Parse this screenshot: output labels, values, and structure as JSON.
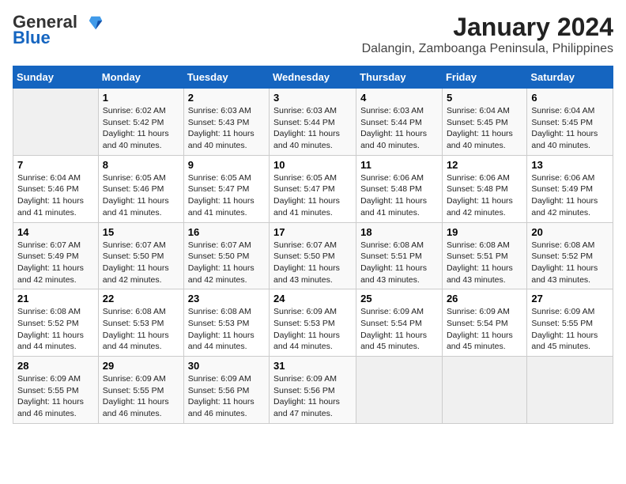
{
  "header": {
    "logo_line1": "General",
    "logo_line2": "Blue",
    "main_title": "January 2024",
    "subtitle": "Dalangin, Zamboanga Peninsula, Philippines"
  },
  "days_of_week": [
    "Sunday",
    "Monday",
    "Tuesday",
    "Wednesday",
    "Thursday",
    "Friday",
    "Saturday"
  ],
  "weeks": [
    [
      {
        "day": "",
        "sunrise": "",
        "sunset": "",
        "daylight": ""
      },
      {
        "day": "1",
        "sunrise": "Sunrise: 6:02 AM",
        "sunset": "Sunset: 5:42 PM",
        "daylight": "Daylight: 11 hours and 40 minutes."
      },
      {
        "day": "2",
        "sunrise": "Sunrise: 6:03 AM",
        "sunset": "Sunset: 5:43 PM",
        "daylight": "Daylight: 11 hours and 40 minutes."
      },
      {
        "day": "3",
        "sunrise": "Sunrise: 6:03 AM",
        "sunset": "Sunset: 5:44 PM",
        "daylight": "Daylight: 11 hours and 40 minutes."
      },
      {
        "day": "4",
        "sunrise": "Sunrise: 6:03 AM",
        "sunset": "Sunset: 5:44 PM",
        "daylight": "Daylight: 11 hours and 40 minutes."
      },
      {
        "day": "5",
        "sunrise": "Sunrise: 6:04 AM",
        "sunset": "Sunset: 5:45 PM",
        "daylight": "Daylight: 11 hours and 40 minutes."
      },
      {
        "day": "6",
        "sunrise": "Sunrise: 6:04 AM",
        "sunset": "Sunset: 5:45 PM",
        "daylight": "Daylight: 11 hours and 40 minutes."
      }
    ],
    [
      {
        "day": "7",
        "sunrise": "Sunrise: 6:04 AM",
        "sunset": "Sunset: 5:46 PM",
        "daylight": "Daylight: 11 hours and 41 minutes."
      },
      {
        "day": "8",
        "sunrise": "Sunrise: 6:05 AM",
        "sunset": "Sunset: 5:46 PM",
        "daylight": "Daylight: 11 hours and 41 minutes."
      },
      {
        "day": "9",
        "sunrise": "Sunrise: 6:05 AM",
        "sunset": "Sunset: 5:47 PM",
        "daylight": "Daylight: 11 hours and 41 minutes."
      },
      {
        "day": "10",
        "sunrise": "Sunrise: 6:05 AM",
        "sunset": "Sunset: 5:47 PM",
        "daylight": "Daylight: 11 hours and 41 minutes."
      },
      {
        "day": "11",
        "sunrise": "Sunrise: 6:06 AM",
        "sunset": "Sunset: 5:48 PM",
        "daylight": "Daylight: 11 hours and 41 minutes."
      },
      {
        "day": "12",
        "sunrise": "Sunrise: 6:06 AM",
        "sunset": "Sunset: 5:48 PM",
        "daylight": "Daylight: 11 hours and 42 minutes."
      },
      {
        "day": "13",
        "sunrise": "Sunrise: 6:06 AM",
        "sunset": "Sunset: 5:49 PM",
        "daylight": "Daylight: 11 hours and 42 minutes."
      }
    ],
    [
      {
        "day": "14",
        "sunrise": "Sunrise: 6:07 AM",
        "sunset": "Sunset: 5:49 PM",
        "daylight": "Daylight: 11 hours and 42 minutes."
      },
      {
        "day": "15",
        "sunrise": "Sunrise: 6:07 AM",
        "sunset": "Sunset: 5:50 PM",
        "daylight": "Daylight: 11 hours and 42 minutes."
      },
      {
        "day": "16",
        "sunrise": "Sunrise: 6:07 AM",
        "sunset": "Sunset: 5:50 PM",
        "daylight": "Daylight: 11 hours and 42 minutes."
      },
      {
        "day": "17",
        "sunrise": "Sunrise: 6:07 AM",
        "sunset": "Sunset: 5:50 PM",
        "daylight": "Daylight: 11 hours and 43 minutes."
      },
      {
        "day": "18",
        "sunrise": "Sunrise: 6:08 AM",
        "sunset": "Sunset: 5:51 PM",
        "daylight": "Daylight: 11 hours and 43 minutes."
      },
      {
        "day": "19",
        "sunrise": "Sunrise: 6:08 AM",
        "sunset": "Sunset: 5:51 PM",
        "daylight": "Daylight: 11 hours and 43 minutes."
      },
      {
        "day": "20",
        "sunrise": "Sunrise: 6:08 AM",
        "sunset": "Sunset: 5:52 PM",
        "daylight": "Daylight: 11 hours and 43 minutes."
      }
    ],
    [
      {
        "day": "21",
        "sunrise": "Sunrise: 6:08 AM",
        "sunset": "Sunset: 5:52 PM",
        "daylight": "Daylight: 11 hours and 44 minutes."
      },
      {
        "day": "22",
        "sunrise": "Sunrise: 6:08 AM",
        "sunset": "Sunset: 5:53 PM",
        "daylight": "Daylight: 11 hours and 44 minutes."
      },
      {
        "day": "23",
        "sunrise": "Sunrise: 6:08 AM",
        "sunset": "Sunset: 5:53 PM",
        "daylight": "Daylight: 11 hours and 44 minutes."
      },
      {
        "day": "24",
        "sunrise": "Sunrise: 6:09 AM",
        "sunset": "Sunset: 5:53 PM",
        "daylight": "Daylight: 11 hours and 44 minutes."
      },
      {
        "day": "25",
        "sunrise": "Sunrise: 6:09 AM",
        "sunset": "Sunset: 5:54 PM",
        "daylight": "Daylight: 11 hours and 45 minutes."
      },
      {
        "day": "26",
        "sunrise": "Sunrise: 6:09 AM",
        "sunset": "Sunset: 5:54 PM",
        "daylight": "Daylight: 11 hours and 45 minutes."
      },
      {
        "day": "27",
        "sunrise": "Sunrise: 6:09 AM",
        "sunset": "Sunset: 5:55 PM",
        "daylight": "Daylight: 11 hours and 45 minutes."
      }
    ],
    [
      {
        "day": "28",
        "sunrise": "Sunrise: 6:09 AM",
        "sunset": "Sunset: 5:55 PM",
        "daylight": "Daylight: 11 hours and 46 minutes."
      },
      {
        "day": "29",
        "sunrise": "Sunrise: 6:09 AM",
        "sunset": "Sunset: 5:55 PM",
        "daylight": "Daylight: 11 hours and 46 minutes."
      },
      {
        "day": "30",
        "sunrise": "Sunrise: 6:09 AM",
        "sunset": "Sunset: 5:56 PM",
        "daylight": "Daylight: 11 hours and 46 minutes."
      },
      {
        "day": "31",
        "sunrise": "Sunrise: 6:09 AM",
        "sunset": "Sunset: 5:56 PM",
        "daylight": "Daylight: 11 hours and 47 minutes."
      },
      {
        "day": "",
        "sunrise": "",
        "sunset": "",
        "daylight": ""
      },
      {
        "day": "",
        "sunrise": "",
        "sunset": "",
        "daylight": ""
      },
      {
        "day": "",
        "sunrise": "",
        "sunset": "",
        "daylight": ""
      }
    ]
  ]
}
